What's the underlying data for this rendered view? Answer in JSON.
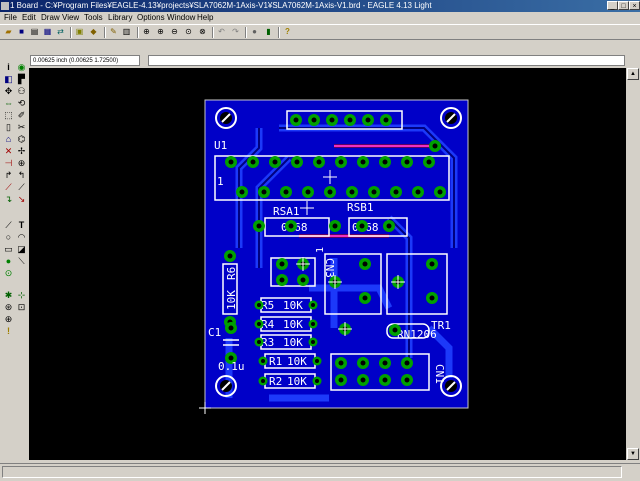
{
  "window": {
    "title": "1 Board - C:¥Program Files¥EAGLE-4.13¥projects¥SLA7062M-1Axis-V1¥SLA7062M-1Axis-V1.brd - EAGLE 4.13 Light"
  },
  "menu": [
    "File",
    "Edit",
    "Draw",
    "View",
    "Tools",
    "Library",
    "Options",
    "Window",
    "Help"
  ],
  "coords": "0.00625 inch (0.00625 1.72500)",
  "pcb": {
    "labels": {
      "u1": "U1",
      "pin1": "1",
      "rsa1": "RSA1",
      "rsb1": "RSB1",
      "rsa1_val": "0.68",
      "rsb1_val": "0.68",
      "r6": "R6",
      "r6_val": "10K",
      "cn3": "CN3",
      "r5": "R5",
      "r4": "R4",
      "r3": "R3",
      "r1": "R1",
      "r2": "R2",
      "val10k": "10K",
      "c1": "C1",
      "c1_val": "0.1u",
      "tr1": "TR1",
      "tr1_val": "RN1206",
      "cn1": "CN1",
      "one_small": "1"
    }
  },
  "colors": {
    "board": "#0000c8",
    "pad": "#00a000",
    "silk": "#ffffff",
    "canvas": "#000000",
    "top_trace": "#c00000"
  }
}
